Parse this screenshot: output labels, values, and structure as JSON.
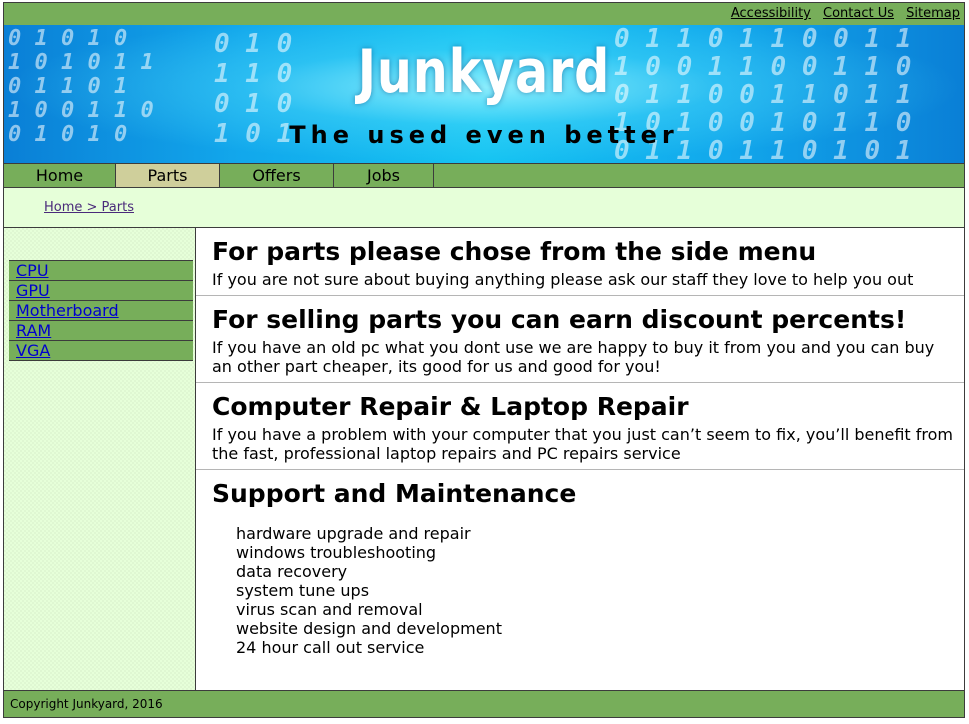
{
  "utility_links": [
    "Accessibility",
    "Contact Us",
    "Sitemap"
  ],
  "banner": {
    "title": "Junkyard",
    "tagline": "The used even better"
  },
  "nav": {
    "items": [
      {
        "label": "Home",
        "active": false
      },
      {
        "label": "Parts",
        "active": true
      },
      {
        "label": "Offers",
        "active": false
      },
      {
        "label": "Jobs",
        "active": false
      }
    ]
  },
  "breadcrumb": "Home > Parts",
  "sidebar": {
    "items": [
      "CPU",
      "GPU",
      "Motherboard",
      "RAM",
      "VGA"
    ]
  },
  "sections": [
    {
      "title": "For parts please chose from the side menu",
      "text": "If you are not sure about buying anything please ask our staff they love to help you out"
    },
    {
      "title": "For selling parts you can earn discount percents!",
      "text": "If you have an old pc what you dont use we are happy to buy it from you and you can buy an other part cheaper, its good for us and good for you!"
    },
    {
      "title": "Computer Repair & Laptop Repair",
      "text": "If you have a problem with your computer that you just can’t seem to fix, you’ll benefit from the fast, professional laptop repairs and PC repairs service"
    },
    {
      "title": "Support and Maintenance",
      "list": [
        "hardware upgrade and repair",
        "windows troubleshooting",
        "data recovery",
        "system tune ups",
        "virus scan and removal",
        "website design and development",
        "24 hour call out service"
      ]
    }
  ],
  "footer": "Copyright Junkyard, 2016",
  "colors": {
    "nav_green": "#77ae5a",
    "active_tab": "#cfcf9b",
    "light_green": "#e6ffd9",
    "link_blue": "#0000cc"
  }
}
